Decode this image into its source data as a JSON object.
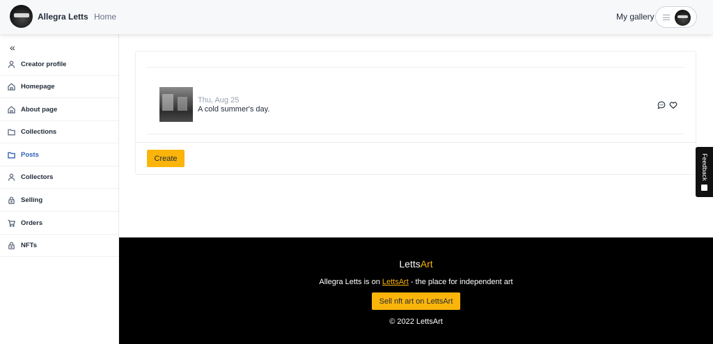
{
  "header": {
    "brand": "Allegra Letts",
    "home": "Home",
    "my_gallery": "My gallery"
  },
  "sidebar": {
    "collapse_glyph": "«",
    "items": [
      {
        "label": "Creator profile",
        "icon": "user-icon"
      },
      {
        "label": "Homepage",
        "icon": "home-icon"
      },
      {
        "label": "About page",
        "icon": "home-icon"
      },
      {
        "label": "Collections",
        "icon": "folder-icon"
      },
      {
        "label": "Posts",
        "icon": "folder-icon",
        "active": true
      },
      {
        "label": "Collectors",
        "icon": "user-icon"
      },
      {
        "label": "Selling",
        "icon": "lock-icon"
      },
      {
        "label": "Orders",
        "icon": "cart-icon"
      },
      {
        "label": "NFTs",
        "icon": "lock-icon"
      }
    ]
  },
  "post": {
    "date": "Thu, Aug 25",
    "title": "A cold summer's day."
  },
  "actions": {
    "create": "Create"
  },
  "feedback": {
    "label": "Feedback"
  },
  "footer": {
    "logo_main": "Letts",
    "logo_accent": "Art",
    "line_prefix": "Allegra Letts is on ",
    "line_link": "LettsArt",
    "line_suffix": " - the place for independent art",
    "sell_button": "Sell nft art on LettsArt",
    "copyright": "© 2022 LettsArt"
  },
  "colors": {
    "accent": "#fbb40a",
    "active_nav": "#2e5fb5",
    "footer_bg": "#000000"
  }
}
